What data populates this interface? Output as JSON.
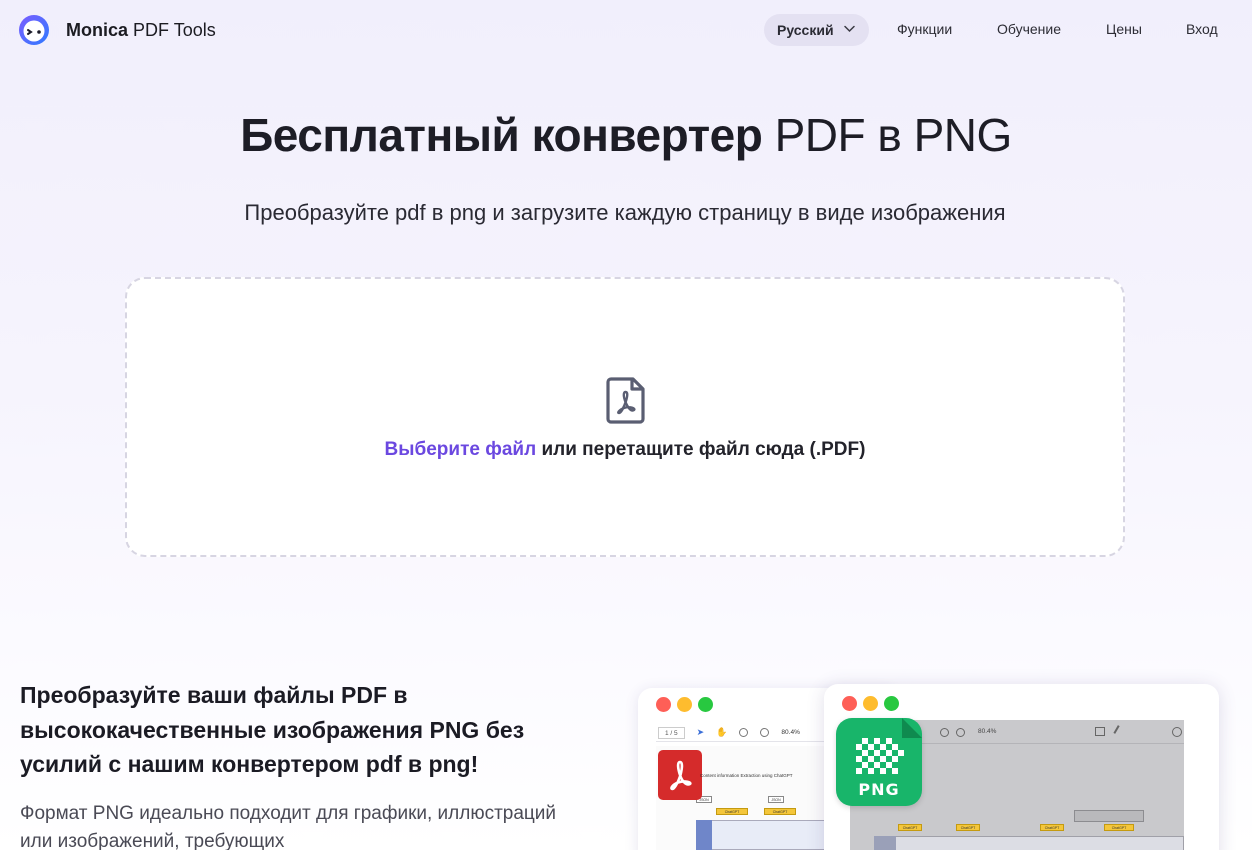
{
  "header": {
    "logo_brand": "Monica",
    "logo_sub": "PDF Tools",
    "language": "Русский",
    "nav": [
      "Функции",
      "Обучение",
      "Цены",
      "Вход"
    ]
  },
  "hero": {
    "title_bold": "Бесплатный конвертер",
    "title_light": "PDF в PNG",
    "subtitle": "Преобразуйте pdf в png и загрузите каждую страницу в виде изображения"
  },
  "upload": {
    "pick_label": "Выберите файл",
    "drop_label": "или перетащите файл сюда (.PDF)",
    "icon": "pdf-file-icon"
  },
  "feature": {
    "title": "Преобразуйте ваши файлы PDF в высококачественные изображения PNG без усилий с нашим конвертером pdf в png!",
    "body": "Формат PNG идеально подходит для графики, иллюстраций или изображений, требующих"
  },
  "illustration": {
    "pdf_window": {
      "page": "1 / 5",
      "zoom": "80.4%",
      "doc_heading": "Content information Extraction using ChatGPT",
      "boxes": [
        "ChatGPT",
        "ChatGPT"
      ],
      "tags": [
        "JSON",
        "JSON"
      ]
    },
    "png_window": {
      "zoom": "80.4%",
      "png_label": "PNG",
      "boxes": [
        "ChatGPT",
        "ChatGPT",
        "ChatGPT",
        "ChatGPT"
      ]
    }
  },
  "colors": {
    "accent": "#6b48e0",
    "pdf_red": "#d52b2b",
    "png_green": "#18b56a"
  }
}
